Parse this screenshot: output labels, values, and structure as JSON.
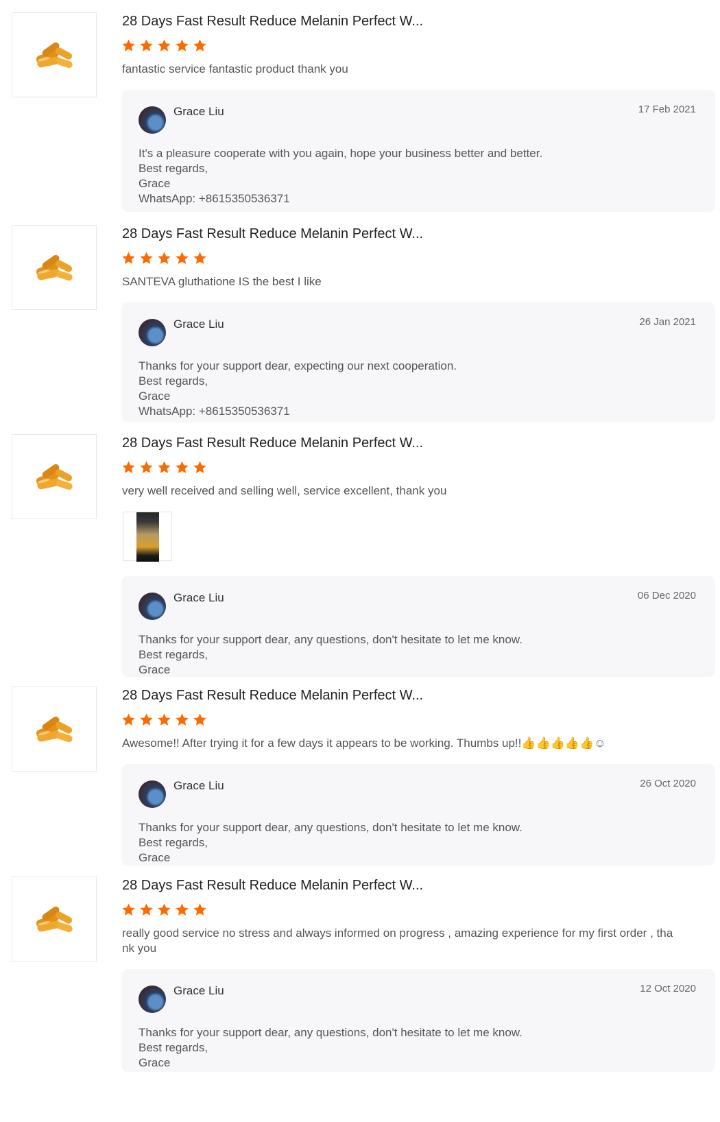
{
  "reviews": [
    {
      "title": "28 Days Fast Result Reduce Melanin Perfect W...",
      "rating": 5,
      "comment": "fantastic service fantastic product thank you",
      "reply": {
        "name": "Grace Liu",
        "date": "17 Feb 2021",
        "lines": [
          "It's a pleasure cooperate with you again, hope your business better and better.",
          "Best regards,",
          "Grace",
          "WhatsApp: +8615350536371"
        ]
      }
    },
    {
      "title": "28 Days Fast Result Reduce Melanin Perfect W...",
      "rating": 5,
      "comment": "SANTEVA gluthatione IS the best I like",
      "reply": {
        "name": "Grace Liu",
        "date": "26 Jan 2021",
        "lines": [
          "Thanks for your support dear, expecting our next cooperation.",
          "Best regards,",
          "Grace",
          "WhatsApp: +8615350536371"
        ]
      }
    },
    {
      "title": "28 Days Fast Result Reduce Melanin Perfect W...",
      "rating": 5,
      "comment": "very well received and selling well, service excellent, thank you",
      "reply": {
        "name": "Grace Liu",
        "date": "06 Dec 2020",
        "lines": [
          "Thanks for your support dear, any questions, don't hesitate to let me know.",
          "Best regards,",
          "Grace"
        ]
      }
    },
    {
      "title": "28 Days Fast Result Reduce Melanin Perfect W...",
      "rating": 5,
      "comment": "Awesome!! After trying it for a few days it appears to be working. Thumbs up!!👍👍👍👍👍☺",
      "reply": {
        "name": "Grace Liu",
        "date": "26 Oct 2020",
        "lines": [
          "Thanks for your support dear, any questions, don't hesitate to let me know.",
          "Best regards,",
          "Grace"
        ]
      }
    },
    {
      "title": "28 Days Fast Result Reduce Melanin Perfect W...",
      "rating": 5,
      "comment": "really good service no stress and always informed on progress , amazing experience for my first order , tha nk you",
      "reply": {
        "name": "Grace Liu",
        "date": "12 Oct 2020",
        "lines": [
          "Thanks for your support dear, any questions, don't hesitate to let me know.",
          "Best regards,",
          "Grace"
        ]
      }
    }
  ],
  "colors": {
    "star": "#ff6a00",
    "reply_bg": "#f7f7f9",
    "capsule": "#e89a22"
  },
  "icons": {
    "star": "star-icon",
    "product": "capsule-product-icon",
    "avatar": "avatar-image"
  }
}
